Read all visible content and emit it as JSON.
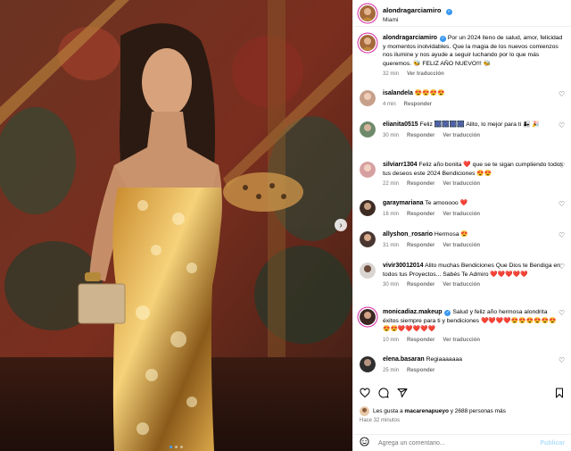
{
  "post": {
    "username": "alondragarciamiro",
    "location": "Miami",
    "caption": "Por un 2024 lleno de salud, amor, felicidad y momentos inolvidables. Que la magia de los nuevos comienzos nos ilumine y nos ayude a seguir luchando por lo que más queremos. 🐝 FELIZ AÑO NUEVO!!! 🐝",
    "caption_time": "32 min",
    "see_translation": "Ver traducción"
  },
  "comments": [
    {
      "user": "isalandela",
      "text": "😍😍😍😍",
      "time": "4 min",
      "reply": "Responder",
      "translate": ""
    },
    {
      "user": "elianita0515",
      "text": "Feliz 🎆🎆🎆🎆 Alito, lo mejor para ti 👩‍👧 🎉",
      "time": "30 min",
      "reply": "Responder",
      "translate": "Ver traducción"
    },
    {
      "user": "silviarr1304",
      "text": "Feliz año bonita ❤️ que se te sigan cumpliendo todos tus deseos este 2024 Bendiciones 😍😍",
      "time": "22 min",
      "reply": "Responder",
      "translate": "Ver traducción"
    },
    {
      "user": "garaymariana",
      "text": "Te amooooo ❤️",
      "time": "16 min",
      "reply": "Responder",
      "translate": "Ver traducción"
    },
    {
      "user": "allyshon_rosario",
      "text": "Hermosa 😍",
      "time": "31 min",
      "reply": "Responder",
      "translate": "Ver traducción"
    },
    {
      "user": "vivir30012014",
      "text": "Alito muchas Bendiciones Que Dios te Bendiga en todos tus Proyectos... Sabés Te Admiro ❤️❤️❤️❤️❤️",
      "time": "30 min",
      "reply": "Responder",
      "translate": "Ver traducción"
    },
    {
      "user": "monicadiaz.makeup",
      "text": "Salud y feliz año hermosa alondrita éxitos siempre para ti y bendiciones ❤️❤️❤️❤️😍😍😍😍😍😍😍😍❤️❤️❤️❤️❤️",
      "time": "10 min",
      "reply": "Responder",
      "translate": "Ver traducción"
    },
    {
      "user": "elena.basaran",
      "text": "Regiaaaaaaa",
      "time": "25 min",
      "reply": "Responder",
      "translate": ""
    }
  ],
  "likes": {
    "prefix": "Les gusta a",
    "user": "macarenapueyo",
    "suffix": "y 2688 personas más"
  },
  "posted_ago": "Hace 32 minutos",
  "comment_input": {
    "placeholder": "Agrega un comentario...",
    "post_label": "Publicar"
  },
  "colors": {
    "verified": "#3897f0",
    "secondary_text": "#737373",
    "heart_red": "#ed4956"
  },
  "icons": [
    "heart-icon",
    "comment-icon",
    "share-icon",
    "bookmark-icon",
    "emoji-icon",
    "chevron-right-icon",
    "verified-icon"
  ]
}
